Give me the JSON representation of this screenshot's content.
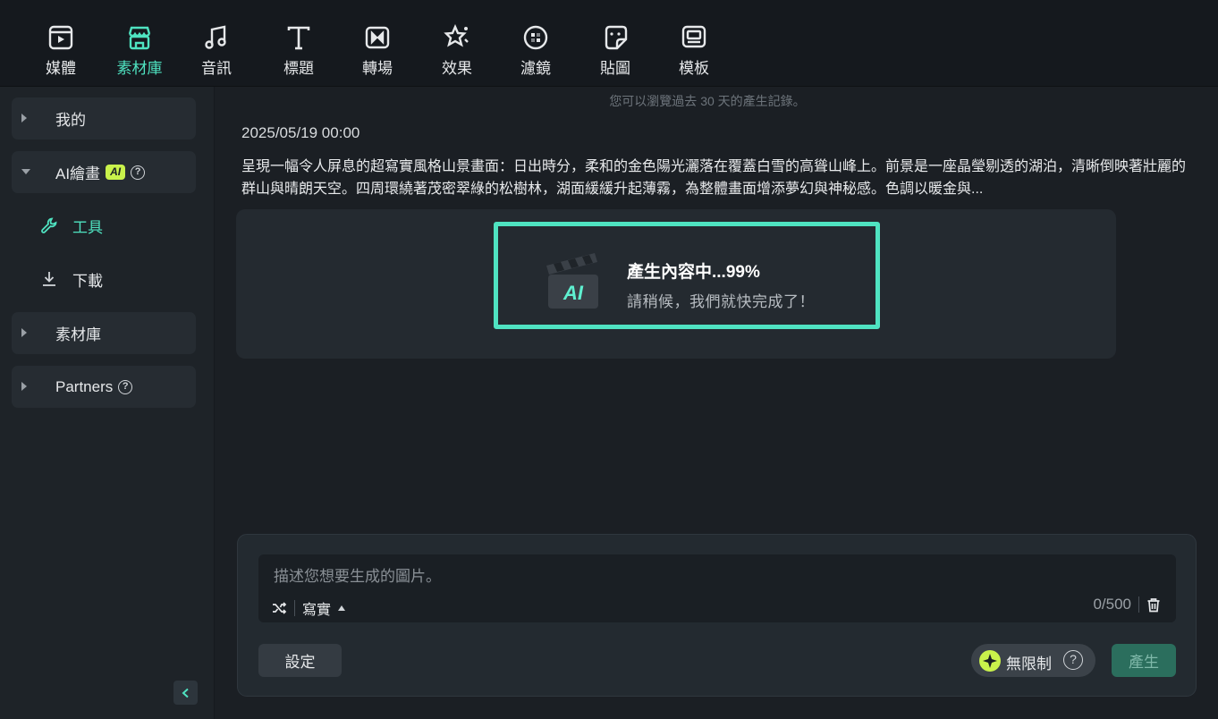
{
  "toolbar": {
    "items": [
      {
        "label": "媒體",
        "icon": "media-icon"
      },
      {
        "label": "素材庫",
        "icon": "store-icon",
        "active": true
      },
      {
        "label": "音訊",
        "icon": "music-icon"
      },
      {
        "label": "標題",
        "icon": "title-icon"
      },
      {
        "label": "轉場",
        "icon": "transition-icon"
      },
      {
        "label": "效果",
        "icon": "effects-icon"
      },
      {
        "label": "濾鏡",
        "icon": "filter-icon"
      },
      {
        "label": "貼圖",
        "icon": "sticker-icon"
      },
      {
        "label": "模板",
        "icon": "template-icon"
      }
    ],
    "accent": "#4fe3c1"
  },
  "sidebar": {
    "groups": {
      "mine": "我的",
      "ai_draw": "AI繪畫",
      "ai_badge": "AI",
      "library": "素材庫",
      "partners": "Partners"
    },
    "items": {
      "tools": "工具",
      "download": "下載"
    }
  },
  "main": {
    "history_hint": "您可以瀏覽過去 30 天的產生記錄。",
    "date": "2025/05/19 00:00",
    "prompt": "呈現一幅令人屏息的超寫實風格山景畫面：日出時分，柔和的金色陽光灑落在覆蓋白雪的高聳山峰上。前景是一座晶瑩剔透的湖泊，清晰倒映著壯麗的群山與晴朗天空。四周環繞著茂密翠綠的松樹林，湖面緩緩升起薄霧，為整體畫面增添夢幻與神秘感。色調以暖金與...",
    "progress_title": "產生內容中...99%",
    "progress_percent": 99,
    "progress_sub": "請稍候，我們就快完成了！",
    "clapper_text": "AI"
  },
  "composer": {
    "placeholder": "描述您想要生成的圖片。",
    "value": "",
    "style": "寫實",
    "counter": "0/500",
    "settings_label": "設定",
    "unlimited_label": "無限制",
    "generate_label": "產生"
  }
}
